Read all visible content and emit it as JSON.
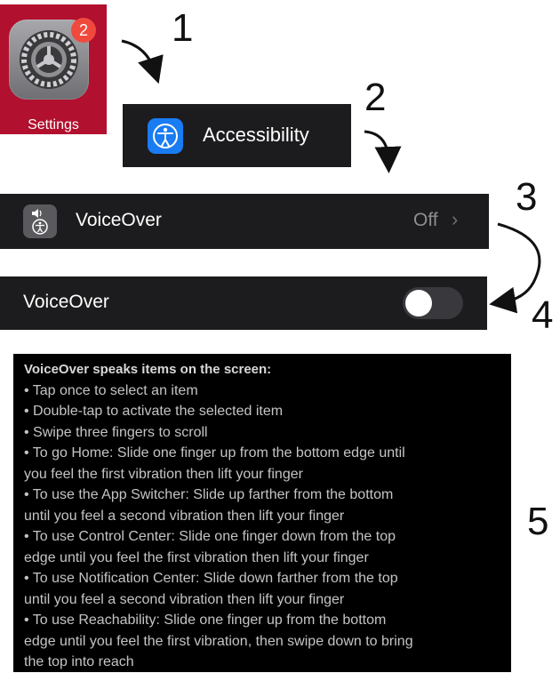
{
  "steps": {
    "step1": "1",
    "step2": "2",
    "step3": "3",
    "step4": "4",
    "step5": "5"
  },
  "settings": {
    "label": "Settings",
    "badge_count": "2",
    "tile_color": "#b2102f"
  },
  "accessibility": {
    "label": "Accessibility",
    "icon": "accessibility-icon",
    "icon_color": "#1a7cf2"
  },
  "voiceover_row": {
    "label": "VoiceOver",
    "value": "Off",
    "icon": "voiceover-icon"
  },
  "voiceover_toggle": {
    "label": "VoiceOver",
    "state": "off"
  },
  "description": {
    "heading": "VoiceOver speaks items on the screen:",
    "lines": [
      "• Tap once to select an item",
      "• Double-tap to activate the selected item",
      "• Swipe three fingers to scroll",
      "• To go Home: Slide one finger up from the bottom edge until",
      "you feel the first vibration then lift your finger",
      "• To use the App Switcher: Slide up farther from the bottom",
      "until you feel a second vibration then lift your finger",
      "• To use Control Center: Slide one finger down from the top",
      "edge until you feel the first vibration then lift your finger",
      "• To use Notification Center: Slide down farther from the top",
      "until you feel a second vibration then lift your finger",
      "• To use Reachability: Slide one finger up from the bottom",
      "edge until you feel the first vibration, then swipe down to bring",
      "the top into reach"
    ]
  }
}
